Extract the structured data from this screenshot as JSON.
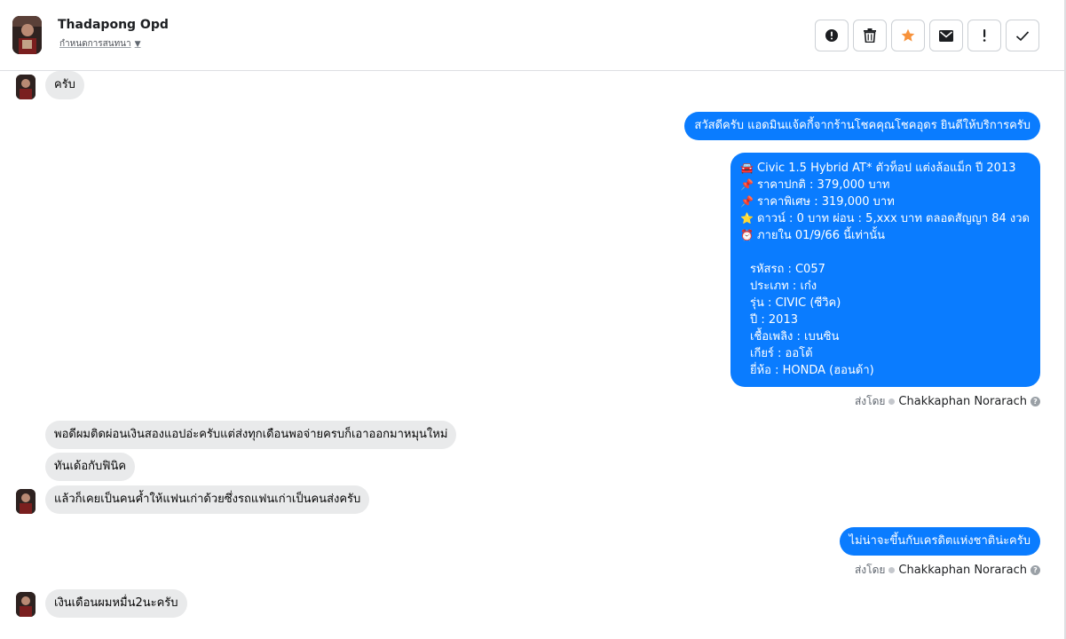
{
  "header": {
    "contact_name": "Thadapong Opd",
    "convo_label": "กำหนดการสนทนา"
  },
  "toolbar": {
    "buttons": [
      {
        "name": "report-button",
        "icon": "alert-circle-icon"
      },
      {
        "name": "delete-button",
        "icon": "trash-icon"
      },
      {
        "name": "star-button",
        "icon": "star-icon"
      },
      {
        "name": "mark-unread-button",
        "icon": "envelope-icon"
      },
      {
        "name": "important-button",
        "icon": "exclamation-icon"
      },
      {
        "name": "done-button",
        "icon": "check-icon"
      }
    ],
    "star_color": "#f7923b"
  },
  "colors": {
    "outgoing_bubble": "#0a7cff",
    "incoming_bubble": "#e9eaeb"
  },
  "messages": {
    "m1": "ครับ",
    "m2": "สวัสดีครับ แอดมินแจ้คกี้จากร้านโชคคุณโชคอุดร ยินดีให้บริการครับ",
    "m3_lines": [
      "Civic 1.5 Hybrid AT* ตัวท็อป แต่งล้อแม็ก ปี 2013",
      "ราคาปกติ : 379,000 บาท",
      "ราคาพิเศษ : 319,000 บาท",
      "ดาวน์ : 0 บาท ผ่อน : 5,xxx บาท ตลอดสัญญา 84 งวด",
      "ภายใน 01/9/66 นี้เท่านั้น",
      "",
      "รหัสรถ : C057",
      "ประเภท : เก๋ง",
      "รุ่น : CIVIC (ซีวิค)",
      "ปี : 2013",
      "เชื้อเพลิง : เบนซิน",
      "เกียร์ : ออโต้",
      "ยี่ห้อ : HONDA (ฮอนด้า)"
    ],
    "m3_emojis": [
      "🚘",
      "📌",
      "📌",
      "⭐",
      "⏰"
    ],
    "sent_by_label": "ส่งโดย",
    "sender": "Chakkaphan Norarach",
    "m4": "พอดีผมติดผ่อนเงินสองแอปอ่ะครับแต่ส่งทุกเดือนพอจ่ายครบก็เอาออกมาหมุนใหม่",
    "m5": "ทันเด้อกับฟินิค",
    "m6": "แล้วก็เคยเป็นคนค้ำให้แฟนเก่าด้วยซึ่งรถแฟนเก่าเป็นคนส่งครับ",
    "m7": "ไม่น่าจะขึ้นกับเครดิตแห่งชาติน่ะครับ",
    "m8": "เงินเดือนผมหมื่น2นะครับ"
  }
}
